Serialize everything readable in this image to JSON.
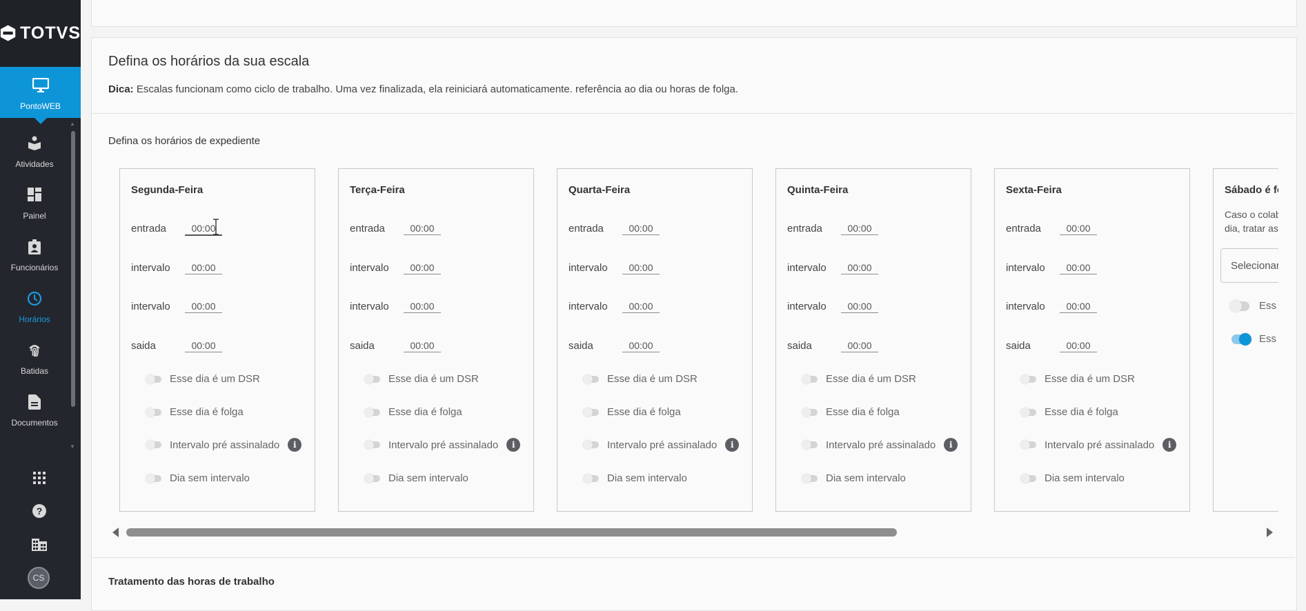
{
  "brand": {
    "logo_text": "TOTVS"
  },
  "sidebar": {
    "active": {
      "label": "PontoWEB",
      "icon": "monitor-icon"
    },
    "items": [
      {
        "label": "Atividades",
        "icon": "activities-icon"
      },
      {
        "label": "Painel",
        "icon": "dashboard-icon"
      },
      {
        "label": "Funcionários",
        "icon": "badge-icon"
      },
      {
        "label": "Horários",
        "icon": "clock-icon"
      },
      {
        "label": "Batidas",
        "icon": "fingerprint-icon"
      },
      {
        "label": "Documentos",
        "icon": "document-icon"
      }
    ],
    "bottom": [
      "apps-grid-icon",
      "help-icon",
      "building-icon"
    ],
    "avatar_initials": "CS"
  },
  "schedule": {
    "title": "Defina os horários da sua escala",
    "tip_label": "Dica:",
    "tip_text": "Escalas funcionam como ciclo de trabalho. Uma vez finalizada, ela reiniciará automaticamente. referência ao dia ou horas de folga.",
    "section_label": "Defina os horários de expediente",
    "time_labels": {
      "entrada": "entrada",
      "intervalo": "intervalo",
      "saida": "saida"
    },
    "toggle_labels": {
      "dsr": "Esse dia é um DSR",
      "folga": "Esse dia é folga",
      "pre": "Intervalo pré assinalado",
      "sem": "Dia sem intervalo"
    },
    "days": [
      {
        "name": "Segunda-Feira",
        "entrada": "00:00",
        "intervalo1": "00:00",
        "intervalo2": "00:00",
        "saida": "00:00"
      },
      {
        "name": "Terça-Feira",
        "entrada": "00:00",
        "intervalo1": "00:00",
        "intervalo2": "00:00",
        "saida": "00:00"
      },
      {
        "name": "Quarta-Feira",
        "entrada": "00:00",
        "intervalo1": "00:00",
        "intervalo2": "00:00",
        "saida": "00:00"
      },
      {
        "name": "Quinta-Feira",
        "entrada": "00:00",
        "intervalo1": "00:00",
        "intervalo2": "00:00",
        "saida": "00:00"
      },
      {
        "name": "Sexta-Feira",
        "entrada": "00:00",
        "intervalo1": "00:00",
        "intervalo2": "00:00",
        "saida": "00:00"
      }
    ],
    "saturday": {
      "title": "Sábado é fo",
      "desc_line1": "Caso o colab",
      "desc_line2": "dia, tratar as",
      "select_placeholder": "Selecionar",
      "toggle1_label": "Ess",
      "toggle2_label": "Ess",
      "toggle2_on": true
    },
    "next_section": "Tratamento das horas de trabalho"
  }
}
